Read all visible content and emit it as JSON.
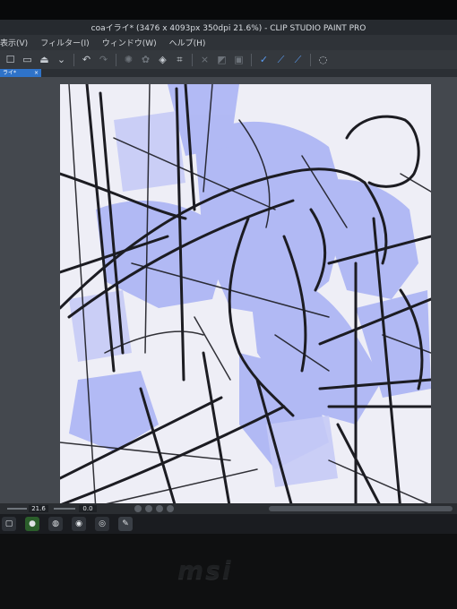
{
  "window": {
    "title": "coaイライ* (3476 x 4093px 350dpi 21.6%)  - CLIP STUDIO PAINT PRO"
  },
  "menu": {
    "items": [
      "表示(V)",
      "フィルター(I)",
      "ウィンドウ(W)",
      "ヘルプ(H)"
    ]
  },
  "toolbar": {
    "icons": [
      "new-icon",
      "open-icon",
      "save-icon",
      "save-menu-icon",
      "undo-icon",
      "redo-icon",
      "clear-icon",
      "fill-icon",
      "transform-icon",
      "crop-icon",
      "snap-off-icon",
      "snap-ruler-icon",
      "snap-grid-icon",
      "pen-pressure-icon",
      "stabilizer-icon",
      "vector-icon",
      "assist-icon"
    ]
  },
  "tab": {
    "label": "ライ*"
  },
  "status": {
    "zoom": "21.6",
    "rotation": "0.0"
  },
  "device": {
    "brand": "msi"
  },
  "colors": {
    "accent": "#2f73c9",
    "sketch_blue": "#9aa4f2",
    "line": "#1c1c22"
  }
}
